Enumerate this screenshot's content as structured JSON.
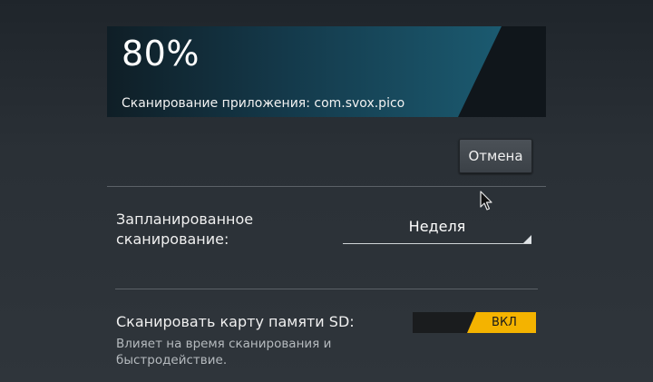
{
  "progress": {
    "percent_label": "80%",
    "fraction": 0.8,
    "status": "Сканирование приложения: com.svox.pico"
  },
  "actions": {
    "cancel_label": "Отмена"
  },
  "schedule": {
    "label": "Запланированное сканирование:",
    "selected": "Неделя"
  },
  "sd_card": {
    "title": "Сканировать карту памяти SD:",
    "description": "Влияет на время сканирования и быстродействие.",
    "toggle_label": "ВКЛ",
    "enabled": true
  },
  "colors": {
    "accent": "#f4b300",
    "progress_fill": "#1b5a70",
    "background": "#2a3036"
  },
  "icons": {
    "cursor": "mouse-pointer-icon",
    "dropdown": "dropdown-triangle-icon"
  }
}
